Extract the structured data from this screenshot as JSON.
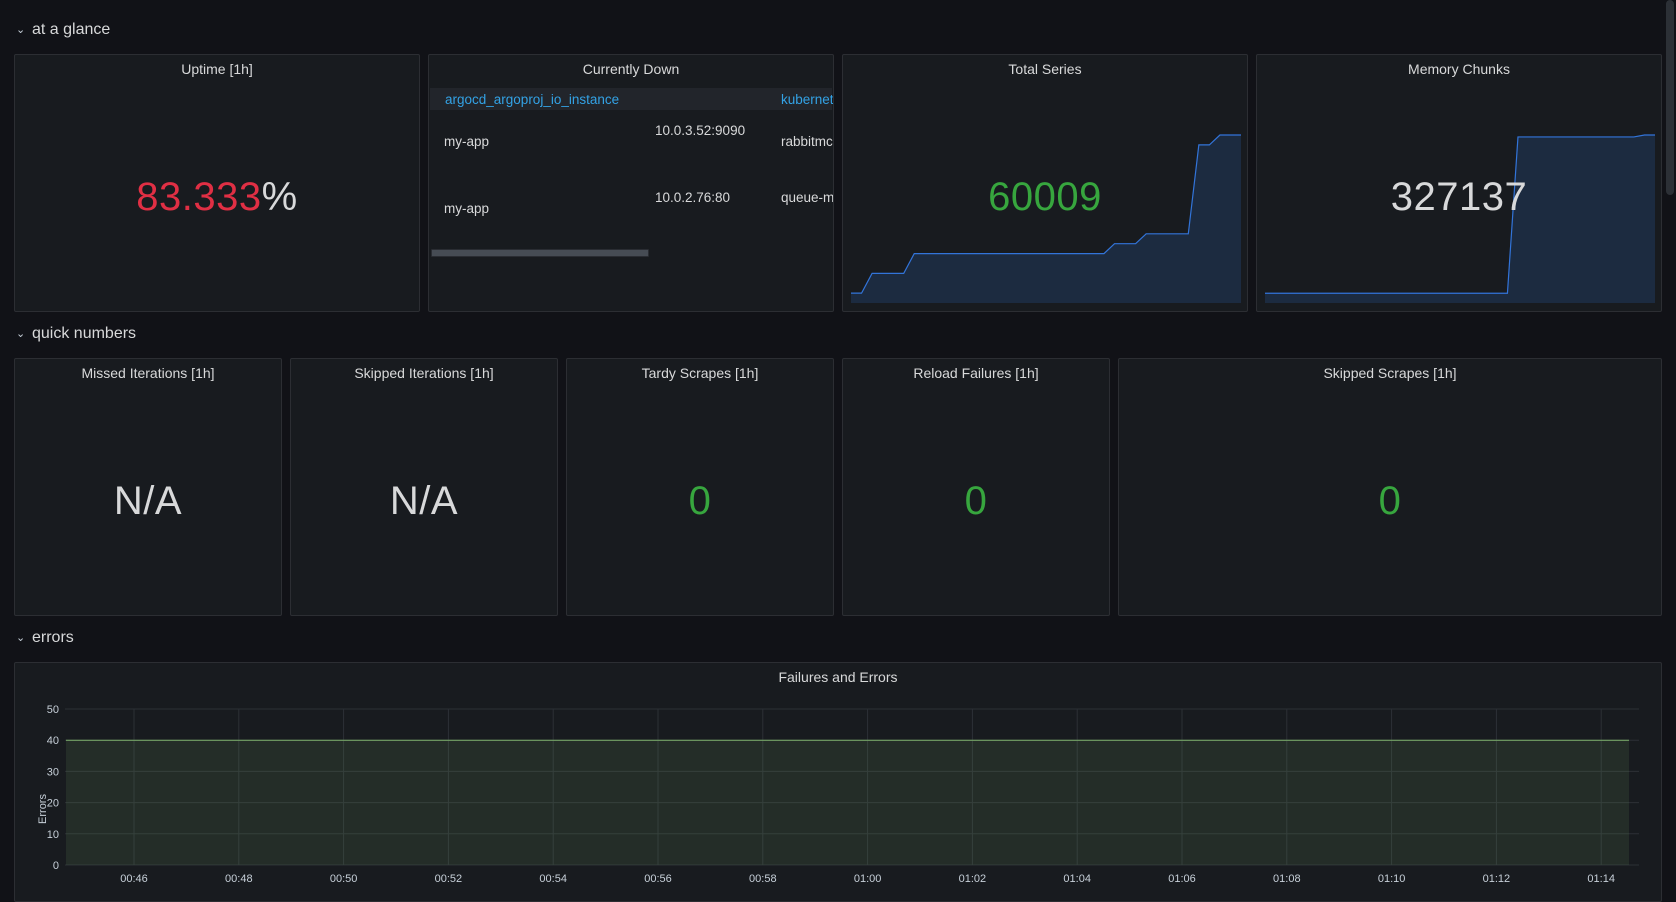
{
  "rows": {
    "at_a_glance": "at a glance",
    "quick_numbers": "quick numbers",
    "errors": "errors"
  },
  "panels": {
    "uptime": {
      "title": "Uptime [1h]",
      "value": "83.333",
      "unit": "%",
      "value_color": "#e02f44"
    },
    "currently_down": {
      "title": "Currently Down",
      "columns": [
        "argocd_argoproj_io_instance",
        "",
        "kubernete"
      ],
      "rows": [
        [
          "my-app",
          "10.0.3.52:9090",
          "rabbitmc"
        ],
        [
          "my-app",
          "10.0.2.76:80",
          "queue-m"
        ]
      ]
    },
    "total_series": {
      "title": "Total Series",
      "value": "60009",
      "value_color": "#37a63e"
    },
    "memory_chunks": {
      "title": "Memory Chunks",
      "value": "327137",
      "value_color": "#d8d9da"
    },
    "missed_iterations": {
      "title": "Missed Iterations [1h]",
      "value": "N/A"
    },
    "skipped_iterations": {
      "title": "Skipped Iterations [1h]",
      "value": "N/A"
    },
    "tardy_scrapes": {
      "title": "Tardy Scrapes [1h]",
      "value": "0"
    },
    "reload_failures": {
      "title": "Reload Failures [1h]",
      "value": "0"
    },
    "skipped_scrapes": {
      "title": "Skipped Scrapes [1h]",
      "value": "0"
    },
    "failures_and_errors": {
      "title": "Failures and Errors"
    }
  },
  "colors": {
    "green": "#37a63e",
    "red": "#e02f44",
    "blue_line": "#3274d9",
    "series_line": "#7eb26d"
  },
  "chart_data": [
    {
      "type": "area",
      "title": "Total Series",
      "y": [
        1,
        1,
        3,
        3,
        3,
        3,
        5,
        5,
        5,
        5,
        5,
        5,
        5,
        5,
        5,
        5,
        5,
        5,
        5,
        5,
        5,
        5,
        5,
        5,
        5,
        6,
        6,
        6,
        7,
        7,
        7,
        7,
        7,
        16,
        16,
        17,
        17,
        17
      ]
    },
    {
      "type": "area",
      "title": "Memory Chunks",
      "y": [
        1,
        1,
        1,
        1,
        1,
        1,
        1,
        1,
        1,
        1,
        1,
        1,
        1,
        1,
        1,
        1,
        1,
        1,
        1,
        1,
        1,
        1,
        1,
        1,
        17,
        17,
        17,
        17,
        17,
        17,
        17,
        17,
        17,
        17,
        17,
        17,
        17.2,
        17.2
      ]
    },
    {
      "type": "area",
      "title": "Failures and Errors",
      "ylabel": "Errors",
      "xlabel": "",
      "ylim": [
        0,
        50
      ],
      "yticks": [
        0,
        10,
        20,
        30,
        40,
        50
      ],
      "categories": [
        "00:46",
        "00:48",
        "00:50",
        "00:52",
        "00:54",
        "00:56",
        "00:58",
        "01:00",
        "01:02",
        "01:04",
        "01:06",
        "01:08",
        "01:10",
        "01:12",
        "01:14"
      ],
      "series": [
        {
          "values": [
            40,
            40,
            40,
            40,
            40,
            40,
            40,
            40,
            40,
            40,
            40,
            40,
            40,
            40,
            40
          ]
        }
      ],
      "grid": true
    }
  ]
}
